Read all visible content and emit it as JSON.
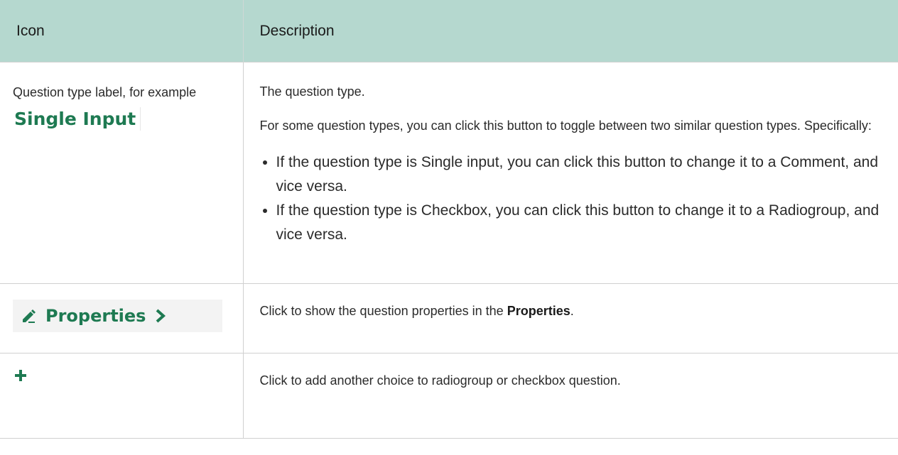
{
  "table": {
    "headers": [
      "Icon",
      "Description"
    ],
    "row1": {
      "icon_text": "Question type label, for example",
      "icon_label": "Single Input",
      "desc_p1": "The question type.",
      "desc_p2": "For some question types, you can click this button to toggle between two similar question types. Specifically:",
      "bullets": [
        "If the question type is Single input, you can click this button to change it to a Comment, and vice versa.",
        "If the question type is Checkbox, you can click this button to change it to a Radiogroup, and vice versa."
      ]
    },
    "row2": {
      "button_label": "Properties",
      "desc_prefix": "Click to show the question properties in the ",
      "desc_bold": "Properties",
      "desc_suffix": "."
    },
    "row3": {
      "icon": "plus-icon",
      "desc": "Click to add another choice to radiogroup or checkbox question."
    }
  },
  "colors": {
    "header_bg": "#b5d8cf",
    "icon_green": "#1e7a52"
  }
}
